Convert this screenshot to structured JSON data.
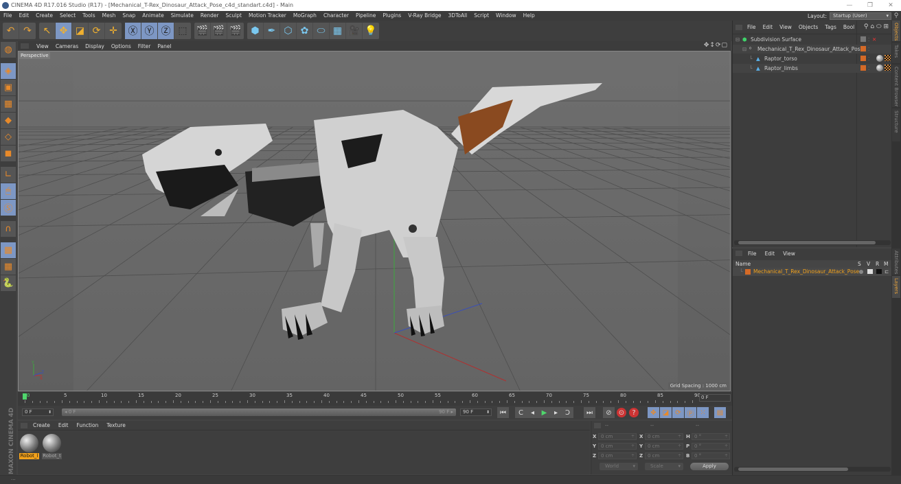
{
  "window": {
    "title": "CINEMA 4D R17.016 Studio (R17) - [Mechanical_T-Rex_Dinosaur_Attack_Pose_c4d_standart.c4d] - Main",
    "controls": [
      "—",
      "❐",
      "✕"
    ]
  },
  "menubar": {
    "items": [
      "File",
      "Edit",
      "Create",
      "Select",
      "Tools",
      "Mesh",
      "Snap",
      "Animate",
      "Simulate",
      "Render",
      "Sculpt",
      "Motion Tracker",
      "MoGraph",
      "Character",
      "Pipeline",
      "Plugins",
      "V-Ray Bridge",
      "3DToAll",
      "Script",
      "Window",
      "Help"
    ],
    "layout_label": "Layout:",
    "layout_value": "Startup (User)"
  },
  "toolbar": {
    "groups": [
      [
        {
          "icon": "undo-icon",
          "glyph": "↶",
          "on": false
        },
        {
          "icon": "redo-icon",
          "glyph": "↷",
          "on": false
        }
      ],
      [
        {
          "icon": "live-selection-icon",
          "glyph": "↖",
          "on": false
        },
        {
          "icon": "move-icon",
          "glyph": "✥",
          "on": true
        },
        {
          "icon": "scale-icon",
          "glyph": "◪",
          "on": false
        },
        {
          "icon": "rotate-icon",
          "glyph": "⟳",
          "on": false
        },
        {
          "icon": "recent-tools-icon",
          "glyph": "✛",
          "on": false
        }
      ],
      [
        {
          "icon": "x-axis-icon",
          "glyph": "Ⓧ",
          "on": true
        },
        {
          "icon": "y-axis-icon",
          "glyph": "Ⓨ",
          "on": true
        },
        {
          "icon": "z-axis-icon",
          "glyph": "Ⓩ",
          "on": true
        },
        {
          "icon": "coordinate-system-icon",
          "glyph": "⬚",
          "on": false
        }
      ],
      [
        {
          "icon": "render-view-icon",
          "glyph": "🎬",
          "on": false
        },
        {
          "icon": "render-picture-viewer-icon",
          "glyph": "🎬",
          "on": false
        },
        {
          "icon": "render-settings-icon",
          "glyph": "🎬",
          "on": false
        }
      ],
      [
        {
          "icon": "cube-icon",
          "glyph": "⬢",
          "on": false
        },
        {
          "icon": "pen-spline-icon",
          "glyph": "✒",
          "on": false
        },
        {
          "icon": "subdivision-surface-icon",
          "glyph": "⬡",
          "on": false
        },
        {
          "icon": "cloner-icon",
          "glyph": "✿",
          "on": false
        },
        {
          "icon": "deformer-icon",
          "glyph": "⬭",
          "on": false
        },
        {
          "icon": "floor-icon",
          "glyph": "▦",
          "on": false
        },
        {
          "icon": "camera-icon",
          "glyph": "🎥",
          "on": false
        },
        {
          "icon": "light-icon",
          "glyph": "💡",
          "on": false
        }
      ]
    ]
  },
  "left_tools": [
    {
      "icon": "make-editable-icon",
      "glyph": "◍",
      "on": false
    },
    {
      "icon": "model-mode-icon",
      "glyph": "◈",
      "on": true
    },
    {
      "icon": "texture-mode-icon",
      "glyph": "▣",
      "on": false
    },
    {
      "icon": "workplane-mode-icon",
      "glyph": "▦",
      "on": false
    },
    {
      "icon": "points-mode-icon",
      "glyph": "◆",
      "on": false
    },
    {
      "icon": "edges-mode-icon",
      "glyph": "◇",
      "on": false
    },
    {
      "icon": "polygons-mode-icon",
      "glyph": "◼",
      "on": false
    },
    {
      "icon": "axis-mode-icon",
      "glyph": "∟",
      "on": false
    },
    {
      "icon": "tweak-mode-icon",
      "glyph": "🖱",
      "on": true
    },
    {
      "icon": "solo-mode-icon",
      "glyph": "Ⓢ",
      "on": true
    },
    {
      "icon": "snap-magnet-icon",
      "glyph": "∩",
      "on": false
    },
    {
      "icon": "workplane-lock-icon",
      "glyph": "▦",
      "on": true
    },
    {
      "icon": "workplane-rotate-icon",
      "glyph": "▦",
      "on": false
    },
    {
      "icon": "python-icon",
      "glyph": "🐍",
      "on": false
    }
  ],
  "viewport": {
    "menu": [
      "View",
      "Cameras",
      "Display",
      "Options",
      "Filter",
      "Panel"
    ],
    "nav_icons": "✥↕⟳▢",
    "camera_label": "Perspective",
    "grid_spacing": "Grid Spacing : 1000 cm",
    "axis_labels": {
      "x": "X",
      "y": "Y",
      "z": "Z"
    }
  },
  "timeline": {
    "start": 0,
    "end": 90,
    "labels": [
      "0",
      "5",
      "10",
      "15",
      "20",
      "25",
      "30",
      "35",
      "40",
      "45",
      "50",
      "55",
      "60",
      "65",
      "70",
      "75",
      "80",
      "85",
      "90"
    ],
    "current_frame": 0,
    "end_field": "0 F"
  },
  "transport": {
    "start_field": "0 F",
    "range_start": "◂ 0 F",
    "range_end": "90 F ▸",
    "end_field": "90 F",
    "buttons": [
      {
        "icon": "go-to-start-icon",
        "glyph": "⏮",
        "on": false
      },
      {
        "icon": "previous-key-icon",
        "glyph": "C",
        "on": false
      },
      {
        "icon": "previous-frame-icon",
        "glyph": "◂",
        "on": false
      },
      {
        "icon": "play-icon",
        "glyph": "▶",
        "on": false
      },
      {
        "icon": "next-frame-icon",
        "glyph": "▸",
        "on": false
      },
      {
        "icon": "next-key-icon",
        "glyph": "Ↄ",
        "on": false
      },
      {
        "icon": "go-to-end-icon",
        "glyph": "⏭",
        "on": false
      },
      {
        "icon": "record-disabled-icon",
        "glyph": "⊘",
        "on": false
      },
      {
        "icon": "record-keys-icon",
        "glyph": "⊙",
        "on": false
      },
      {
        "icon": "autokey-icon",
        "glyph": "?",
        "on": false
      },
      {
        "icon": "key-position-icon",
        "glyph": "✥",
        "on": true
      },
      {
        "icon": "key-scale-icon",
        "glyph": "◪",
        "on": true
      },
      {
        "icon": "key-rotation-icon",
        "glyph": "⟳",
        "on": true
      },
      {
        "icon": "key-parameter-icon",
        "glyph": "Ⓟ",
        "on": true
      },
      {
        "icon": "key-pla-icon",
        "glyph": "⁙",
        "on": true
      },
      {
        "icon": "timeline-window-icon",
        "glyph": "▤",
        "on": true
      }
    ]
  },
  "materials": {
    "menu": [
      "Create",
      "Edit",
      "Function",
      "Texture"
    ],
    "items": [
      {
        "name": "Robot_l",
        "selected": true
      },
      {
        "name": "Robot_t",
        "selected": false
      }
    ],
    "brand": "MAXON CINEMA 4D"
  },
  "coordinates": {
    "headers": [
      "--",
      "--",
      "--"
    ],
    "rows": [
      {
        "l1": "X",
        "v1": "0 cm",
        "l2": "X",
        "v2": "0 cm",
        "l3": "H",
        "v3": "0 °"
      },
      {
        "l1": "Y",
        "v1": "0 cm",
        "l2": "Y",
        "v2": "0 cm",
        "l3": "P",
        "v3": "0 °"
      },
      {
        "l1": "Z",
        "v1": "0 cm",
        "l2": "Z",
        "v2": "0 cm",
        "l3": "B",
        "v3": "0 °"
      }
    ],
    "mode_dropdown": "World",
    "transform_dropdown": "Scale",
    "apply_label": "Apply"
  },
  "objects": {
    "menu": [
      "File",
      "Edit",
      "View",
      "Objects",
      "Tags",
      "Bool"
    ],
    "tree": [
      {
        "name": "Subdivision Surface",
        "indent": 0,
        "icon": "subdivision-surface-icon",
        "layer_color": "",
        "tags": []
      },
      {
        "name": "Mechanical_T_Rex_Dinosaur_Attack_Pose",
        "indent": 1,
        "icon": "null-object-icon",
        "layer_color": "#d46a27",
        "tags": []
      },
      {
        "name": "Raptor_torso",
        "indent": 2,
        "icon": "polygon-object-icon",
        "layer_color": "#d46a27",
        "tags": [
          "material",
          "checker"
        ]
      },
      {
        "name": "Raptor_limbs",
        "indent": 2,
        "icon": "polygon-object-icon",
        "layer_color": "#d46a27",
        "tags": [
          "material",
          "checker"
        ]
      }
    ]
  },
  "layers": {
    "menu": [
      "File",
      "Edit",
      "View"
    ],
    "header": {
      "name": "Name",
      "cols": [
        "S",
        "V",
        "R",
        "M"
      ]
    },
    "rows": [
      {
        "name": "Mechanical_T_Rex_Dinosaur_Attack_Pose",
        "color": "#d46a27"
      }
    ]
  },
  "side_tabs": {
    "top": [
      {
        "label": "Objects",
        "active": true
      },
      {
        "label": "Takes",
        "active": false
      },
      {
        "label": "Content Browser",
        "active": false
      },
      {
        "label": "Structure",
        "active": false
      }
    ],
    "bottom": [
      {
        "label": "Attributes",
        "active": false
      },
      {
        "label": "Layers",
        "active": true
      }
    ]
  },
  "status": {
    "text": "..."
  },
  "colors": {
    "accent": "#f3a21b",
    "toggle_on": "#7d97c4",
    "layer": "#d46a27",
    "current_frame": "#4fd66c"
  }
}
